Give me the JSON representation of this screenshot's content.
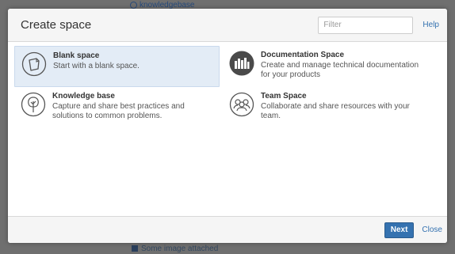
{
  "background": {
    "top_link": "knowledgebase",
    "bottom_text": "Some image attached"
  },
  "dialog": {
    "title": "Create space",
    "filter_placeholder": "Filter",
    "help_label": "Help",
    "next_label": "Next",
    "close_label": "Close",
    "accent_color": "#3572b0",
    "selected_color": "#e3ecf6"
  },
  "blueprints": [
    {
      "name": "Blank space",
      "desc": "Start with a blank space.",
      "icon": "blank-space-icon",
      "selected": true
    },
    {
      "name": "Documentation Space",
      "desc": "Create and manage technical documentation for your products",
      "icon": "documentation-space-icon",
      "selected": false
    },
    {
      "name": "Knowledge base",
      "desc": "Capture and share best practices and solutions to common problems.",
      "icon": "knowledge-base-icon",
      "selected": false
    },
    {
      "name": "Team Space",
      "desc": "Collaborate and share resources with your team.",
      "icon": "team-space-icon",
      "selected": false
    }
  ]
}
